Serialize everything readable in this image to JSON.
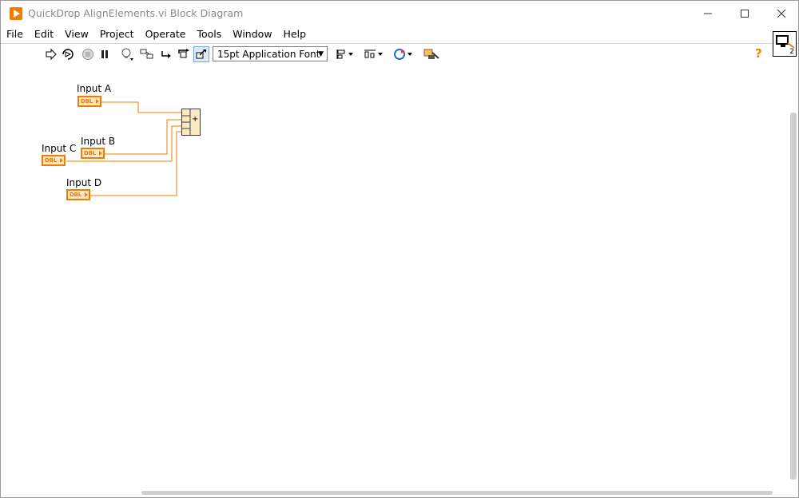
{
  "window": {
    "title": "QuickDrop AlignElements.vi Block Diagram",
    "accent": "#f07d00"
  },
  "menu": {
    "items": [
      "File",
      "Edit",
      "View",
      "Project",
      "Operate",
      "Tools",
      "Window",
      "Help"
    ]
  },
  "toolbar": {
    "font_value": "15pt Application Font",
    "help_glyph": "?",
    "vi_icon_number": "2"
  },
  "diagram": {
    "terminals": [
      {
        "label": "Input A",
        "type": "DBL"
      },
      {
        "label": "Input B",
        "type": "DBL"
      },
      {
        "label": "Input C",
        "type": "DBL"
      },
      {
        "label": "Input D",
        "type": "DBL"
      }
    ],
    "node_operator": "+",
    "wire_color": "#f07d00"
  }
}
